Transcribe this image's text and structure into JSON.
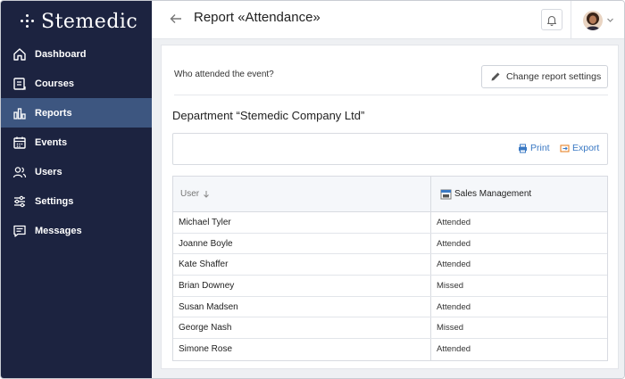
{
  "app": {
    "logo_text": "Stemedic"
  },
  "sidebar": {
    "items": [
      {
        "label": "Dashboard",
        "icon": "home-icon",
        "active": false
      },
      {
        "label": "Courses",
        "icon": "courses-icon",
        "active": false
      },
      {
        "label": "Reports",
        "icon": "bar-chart-icon",
        "active": true
      },
      {
        "label": "Events",
        "icon": "calendar-icon",
        "active": false
      },
      {
        "label": "Users",
        "icon": "users-icon",
        "active": false
      },
      {
        "label": "Settings",
        "icon": "sliders-icon",
        "active": false
      },
      {
        "label": "Messages",
        "icon": "message-icon",
        "active": false
      }
    ]
  },
  "header": {
    "title": "Report «Attendance»"
  },
  "report": {
    "question": "Who attended the event?",
    "change_settings_label": "Change report settings",
    "department": "Department “Stemedic Company Ltd”",
    "print_label": "Print",
    "export_label": "Export"
  },
  "table": {
    "columns": [
      "User",
      "Sales Management"
    ],
    "rows": [
      {
        "user": "Michael Tyler",
        "status": "Attended"
      },
      {
        "user": "Joanne Boyle",
        "status": "Attended"
      },
      {
        "user": "Kate Shaffer",
        "status": "Attended"
      },
      {
        "user": "Brian Downey",
        "status": "Missed"
      },
      {
        "user": "Susan Madsen",
        "status": "Attended"
      },
      {
        "user": "George Nash",
        "status": "Missed"
      },
      {
        "user": "Simone Rose",
        "status": "Attended"
      }
    ]
  },
  "colors": {
    "sidebar_bg": "#1c2340",
    "active_item": "#3d5680",
    "link": "#3a79c4"
  }
}
